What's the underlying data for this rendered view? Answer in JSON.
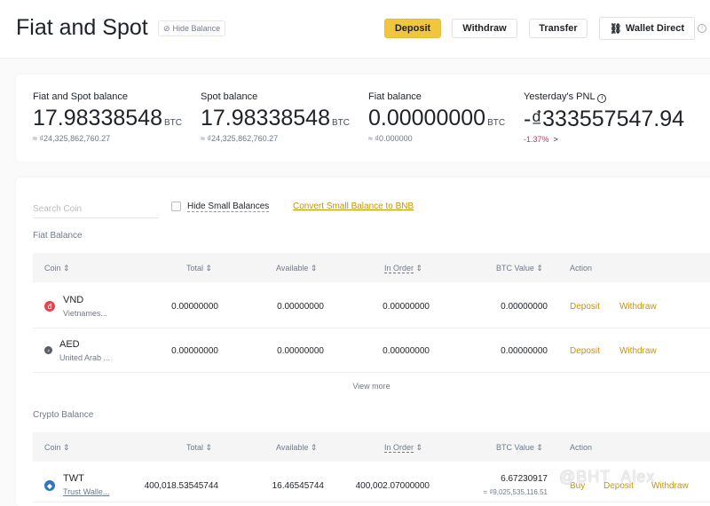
{
  "header": {
    "title": "Fiat and Spot",
    "hide_balance": "Hide Balance",
    "deposit": "Deposit",
    "withdraw": "Withdraw",
    "transfer": "Transfer",
    "wallet_direct": "Wallet Direct"
  },
  "balances": [
    {
      "label": "Fiat and Spot balance",
      "value": "17.98338548",
      "unit": "BTC",
      "approx": "≈ ₫24,325,862,760.27"
    },
    {
      "label": "Spot balance",
      "value": "17.98338548",
      "unit": "BTC",
      "approx": "≈ ₫24,325,862,760.27"
    },
    {
      "label": "Fiat balance",
      "value": "0.00000000",
      "unit": "BTC",
      "approx": "≈ ₫0.000000"
    }
  ],
  "pnl": {
    "label": "Yesterday's PNL",
    "value": "-₫333557547.94",
    "percent": "-1.37%",
    "arrow": ">"
  },
  "filters": {
    "search_placeholder": "Search Coin",
    "hide_small": "Hide Small Balances",
    "convert": "Convert Small Balance to BNB"
  },
  "fiat": {
    "title": "Fiat Balance",
    "columns": [
      "Coin",
      "Total",
      "Available",
      "In Order",
      "BTC Value",
      "Action"
    ],
    "rows": [
      {
        "symbol": "VND",
        "name": "Vietnames...",
        "total": "0.00000000",
        "available": "0.00000000",
        "in_order": "0.00000000",
        "btc": "0.00000000",
        "actions": [
          "Deposit",
          "Withdraw"
        ],
        "color": "#e0474f",
        "glyph": "đ"
      },
      {
        "symbol": "AED",
        "name": "United Arab ...",
        "total": "0.00000000",
        "available": "0.00000000",
        "in_order": "0.00000000",
        "btc": "0.00000000",
        "actions": [
          "Deposit",
          "Withdraw"
        ],
        "color": "#5a5f66",
        "glyph": "د"
      }
    ],
    "view_more": "View more"
  },
  "crypto": {
    "title": "Crypto Balance",
    "columns": [
      "Coin",
      "Total",
      "Available",
      "In Order",
      "BTC Value",
      "Action"
    ],
    "rows": [
      {
        "symbol": "TWT",
        "name": "Trust Walle...",
        "total": "400,018.53545744",
        "available": "16.46545744",
        "in_order": "400,002.07000000",
        "btc": "6.67230917",
        "btc_approx": "≈ ₫9,025,535,116.51",
        "actions": [
          "Buy",
          "Deposit",
          "Withdraw"
        ],
        "color": "#3375bb"
      }
    ]
  },
  "watermark": "@BHT_Alex"
}
